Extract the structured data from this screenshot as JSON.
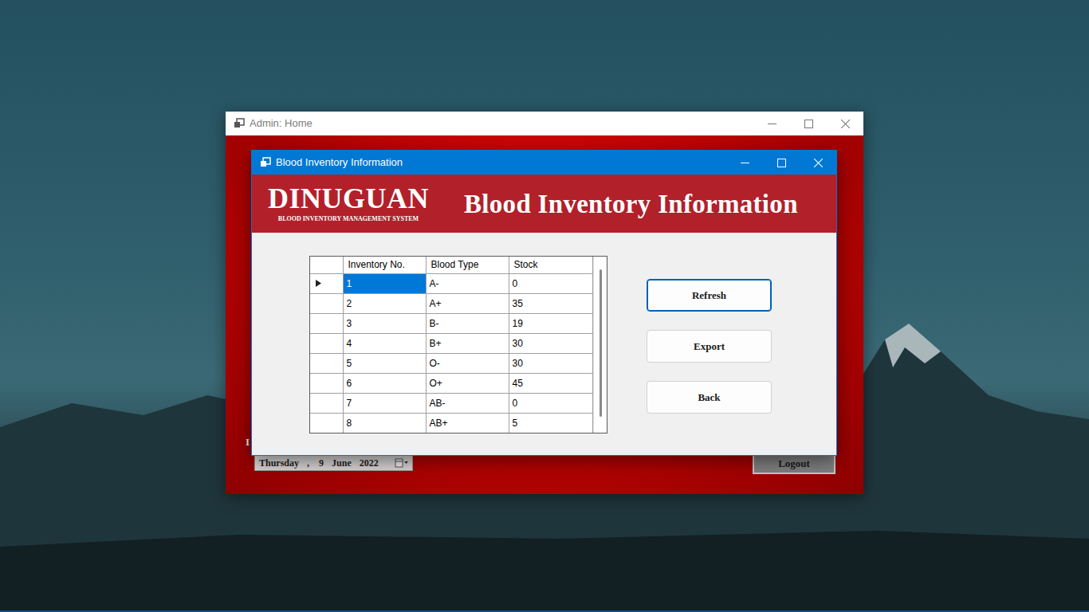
{
  "home_window": {
    "title": "Admin: Home",
    "partial_label": "I",
    "date_parts": [
      "Thursday",
      ",",
      "9",
      "June",
      "2022"
    ],
    "logout_button": "Logout"
  },
  "dialog": {
    "title": "Blood Inventory Information",
    "logo": "DINUGUAN",
    "logo_subtitle": "BLOOD INVENTORY MANAGEMENT SYSTEM",
    "heading": "Blood Inventory Information"
  },
  "table": {
    "columns": [
      "Inventory No.",
      "Blood Type",
      "Stock"
    ],
    "rows": [
      {
        "cells": [
          "1",
          "A-",
          "0"
        ],
        "selected": true
      },
      {
        "cells": [
          "2",
          "A+",
          "35"
        ],
        "selected": false
      },
      {
        "cells": [
          "3",
          "B-",
          "19"
        ],
        "selected": false
      },
      {
        "cells": [
          "4",
          "B+",
          "30"
        ],
        "selected": false
      },
      {
        "cells": [
          "5",
          "O-",
          "30"
        ],
        "selected": false
      },
      {
        "cells": [
          "6",
          "O+",
          "45"
        ],
        "selected": false
      },
      {
        "cells": [
          "7",
          "AB-",
          "0"
        ],
        "selected": false
      },
      {
        "cells": [
          "8",
          "AB+",
          "5"
        ],
        "selected": false
      }
    ]
  },
  "buttons": [
    {
      "label": "Refresh",
      "focused": true
    },
    {
      "label": "Export",
      "focused": false
    },
    {
      "label": "Back",
      "focused": false
    }
  ]
}
